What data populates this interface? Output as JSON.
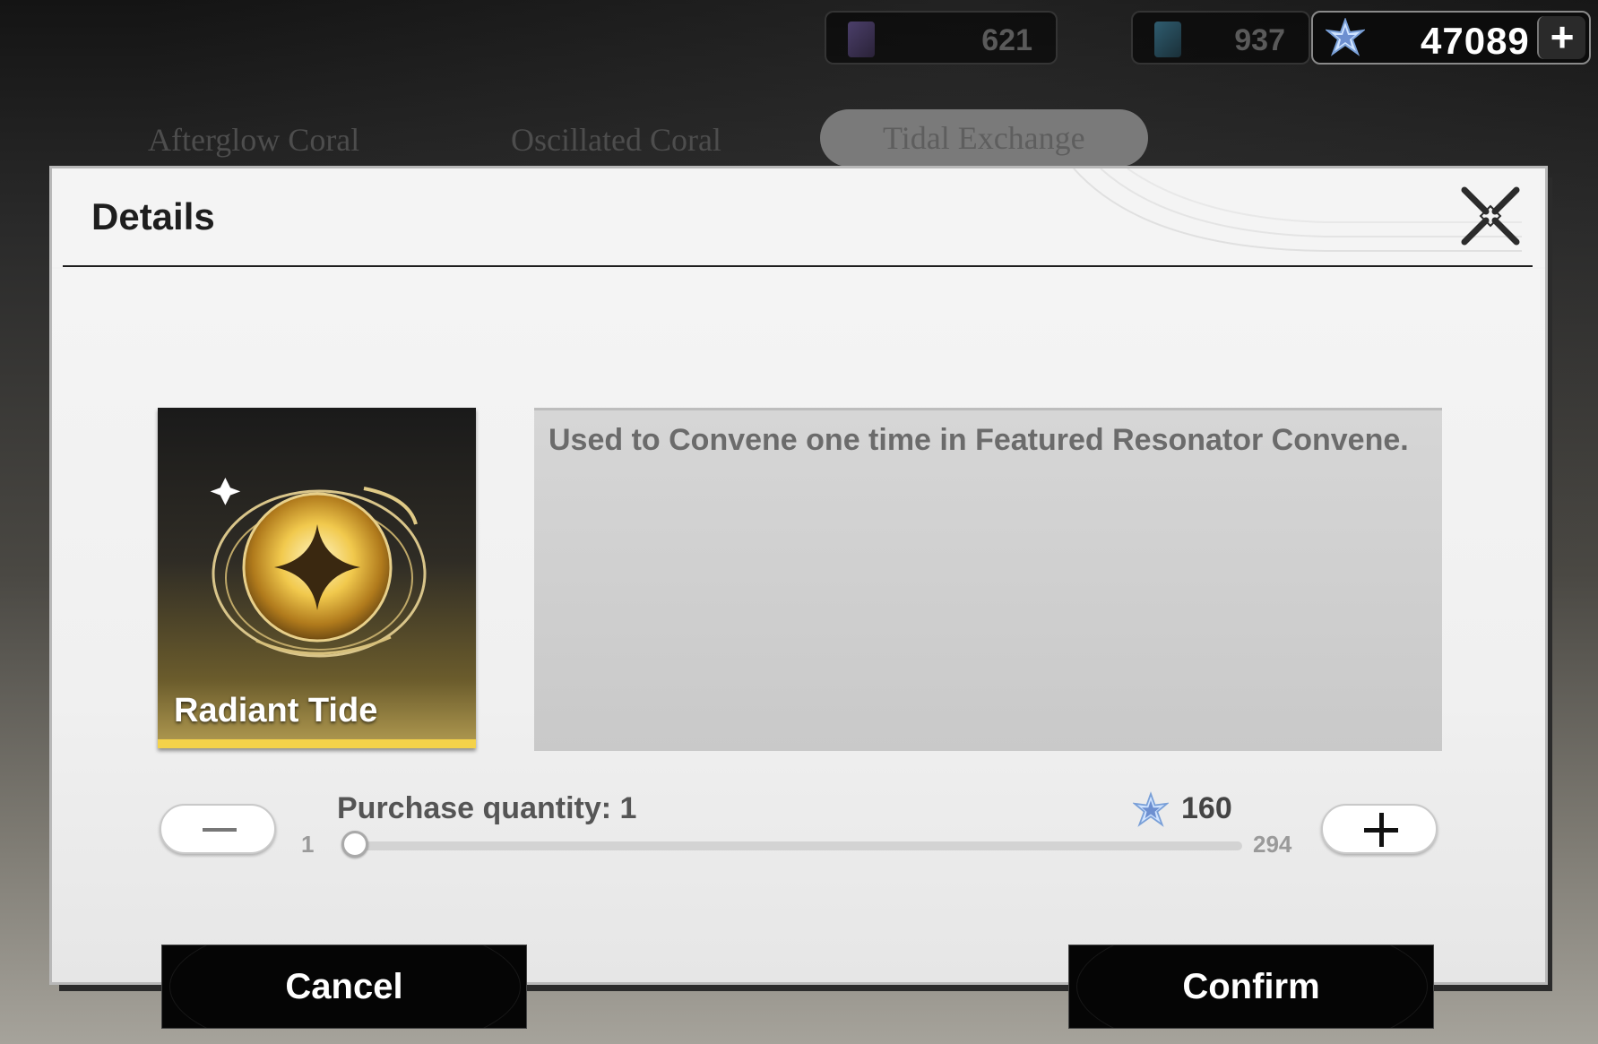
{
  "currency": {
    "dim1": {
      "value": "621"
    },
    "dim2": {
      "value": "937"
    },
    "main": {
      "value": "47089",
      "add_label": "+",
      "icon": "astrite-star-icon"
    }
  },
  "background_tabs": [
    "Afterglow Coral",
    "Oscillated Coral",
    "Tidal Exchange"
  ],
  "dialog": {
    "title": "Details",
    "close_icon": "close-x-icon",
    "item": {
      "name": "Radiant Tide",
      "icon": "radiant-tide-orb-icon",
      "rarity_color": "#f4d24a"
    },
    "description": "Used to Convene one time in Featured Resonator Convene.",
    "quantity": {
      "label": "Purchase quantity: 1",
      "current": 1,
      "min_label": "1",
      "max_label": "294",
      "min": 1,
      "max": 294,
      "price": "160",
      "price_icon": "astrite-star-icon",
      "minus_label": "−",
      "plus_label": "+"
    },
    "cancel_label": "Cancel",
    "confirm_label": "Confirm"
  }
}
